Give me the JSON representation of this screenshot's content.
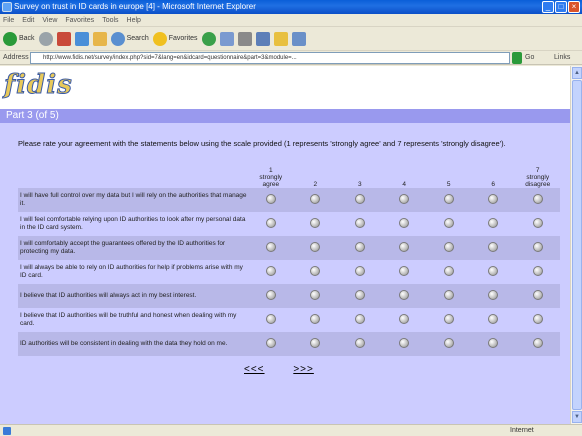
{
  "window": {
    "title": "Survey on trust in ID cards in europe [4] - Microsoft Internet Explorer",
    "min_glyph": "_",
    "max_glyph": "□",
    "close_glyph": "×"
  },
  "menu": [
    "File",
    "Edit",
    "View",
    "Favorites",
    "Tools",
    "Help"
  ],
  "toolbar": {
    "back_label": "Back",
    "search_label": "Search",
    "favorites_label": "Favorites"
  },
  "address": {
    "label": "Address",
    "url": "http://www.fidis.net/survey/index.php?sid=7&lang=en&idcard=questionnaire&part=3&module=...",
    "go_label": "Go",
    "links_label": "Links"
  },
  "page": {
    "logo_text": "fidis",
    "part_title": "Part 3 (of 5)",
    "instructions": "Please rate your agreement with the statements below using the scale provided (1 represents 'strongly agree' and 7 represents 'strongly disagree').",
    "scale_headers": [
      "1\nstrongly\nagree",
      "2",
      "3",
      "4",
      "5",
      "6",
      "7\nstrongly\ndisagree"
    ],
    "statements": [
      "I will have full control over my data but I will rely on the authorities that manage it.",
      "I will feel comfortable relying upon ID authorities to look after my personal data in the ID card system.",
      "I will comfortably accept the guarantees offered by the ID authorities for protecting my data.",
      "I will always be able to rely on ID authorities for help if problems arise with my ID card.",
      "I believe that ID authorities will always act in my best interest.",
      "I believe that ID authorities will be truthful and honest when dealing with my card.",
      "ID authorities will be consistent in dealing with the data they hold on me."
    ],
    "nav_prev": "<<<",
    "nav_next": ">>>"
  },
  "status": {
    "text": "",
    "zone": "Internet"
  }
}
